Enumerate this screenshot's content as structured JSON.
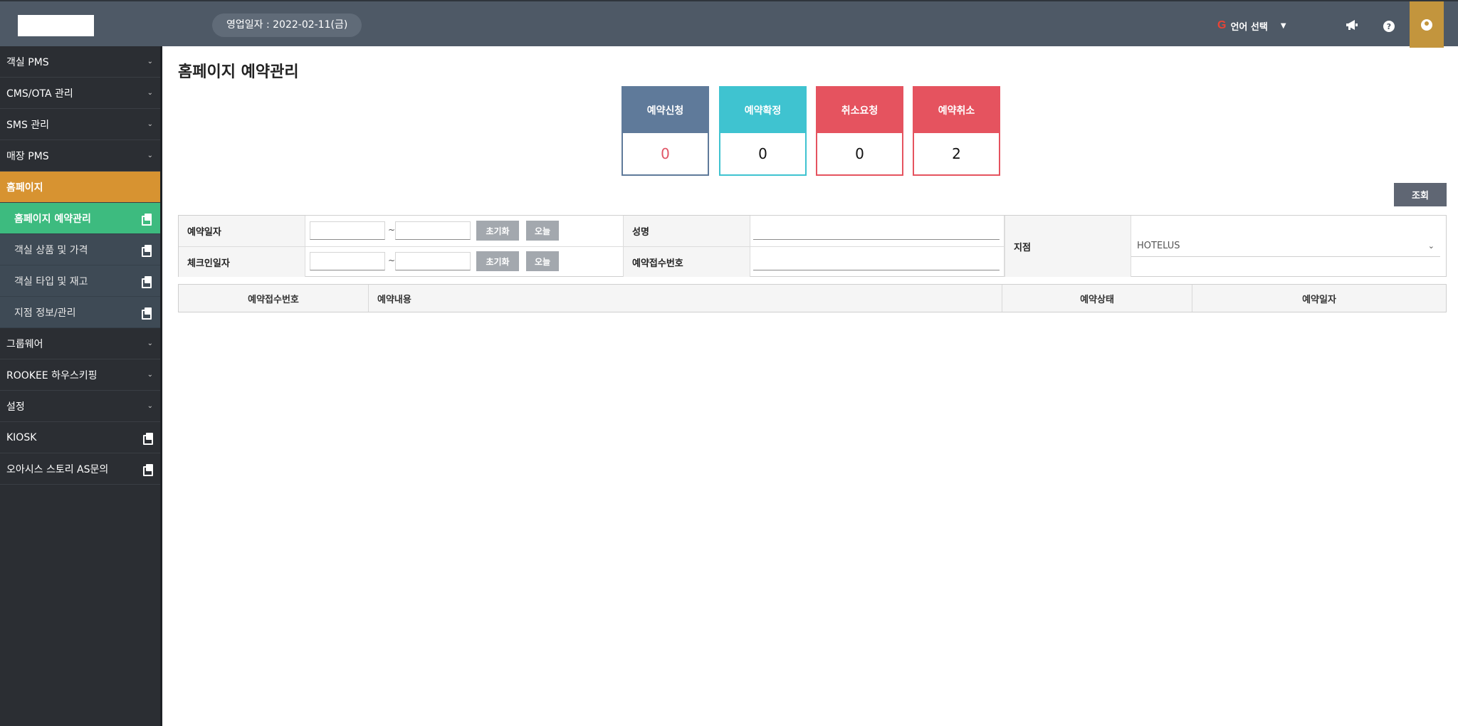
{
  "header": {
    "business_date": "영업일자 : 2022-02-11(금)",
    "language_label": "언어 선택",
    "google_letter": "G"
  },
  "sidebar": {
    "items": [
      {
        "label": "객실 PMS"
      },
      {
        "label": "CMS/OTA 관리"
      },
      {
        "label": "SMS 관리"
      },
      {
        "label": "매장 PMS"
      },
      {
        "label": "홈페이지"
      },
      {
        "label": "홈페이지 예약관리"
      },
      {
        "label": "객실 상품 및 가격"
      },
      {
        "label": "객실 타입 및 재고"
      },
      {
        "label": "지점 정보/관리"
      },
      {
        "label": "그룹웨어"
      },
      {
        "label": "ROOKEE 하우스키핑"
      },
      {
        "label": "설정"
      },
      {
        "label": "KIOSK"
      },
      {
        "label": "오아시스 스토리 AS문의"
      }
    ]
  },
  "page": {
    "title": "홈페이지 예약관리"
  },
  "status_cards": [
    {
      "label": "예약신청",
      "value": "0",
      "color": "#5f7a9a",
      "value_color": "#e05566"
    },
    {
      "label": "예약확정",
      "value": "0",
      "color": "#3fc3d0",
      "value_color": "#111111"
    },
    {
      "label": "취소요청",
      "value": "0",
      "color": "#e5535f",
      "value_color": "#111111"
    },
    {
      "label": "예약취소",
      "value": "2",
      "color": "#e5535f",
      "value_color": "#111111"
    }
  ],
  "search": {
    "query_button": "조회",
    "reservation_date_label": "예약일자",
    "checkin_date_label": "체크인일자",
    "reset_label": "초기화",
    "today_label": "오늘",
    "tilde": "~",
    "name_label": "성명",
    "reservation_no_label": "예약접수번호",
    "branch_label": "지점",
    "branch_value": "HOTELUS"
  },
  "list": {
    "columns": [
      "예약접수번호",
      "예약내용",
      "예약상태",
      "예약일자"
    ]
  }
}
